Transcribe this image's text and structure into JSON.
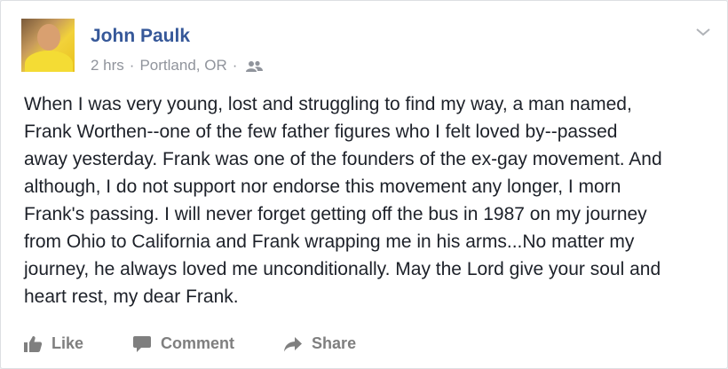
{
  "post": {
    "author": "John Paulk",
    "time": "2 hrs",
    "location": "Portland, OR",
    "audience_icon": "friends-icon",
    "text": "When I was very young, lost and struggling to find my way, a man named,\nFrank Worthen--one of the few father figures who I felt loved by--passed\naway yesterday. Frank was one of the founders of the ex-gay movement. And\nalthough, I do not support nor endorse this movement any longer, I morn\nFrank's passing. I will never forget getting off the bus in 1987 on my journey\nfrom Ohio to California and Frank wrapping me in his arms...No matter my\njourney, he always loved me unconditionally. May the Lord give your soul and\nheart rest, my dear Frank."
  },
  "actions": {
    "like": "Like",
    "comment": "Comment",
    "share": "Share"
  },
  "colors": {
    "author_link": "#365899",
    "meta": "#90949c",
    "body_text": "#1d2129",
    "action": "#7f7f7f"
  }
}
